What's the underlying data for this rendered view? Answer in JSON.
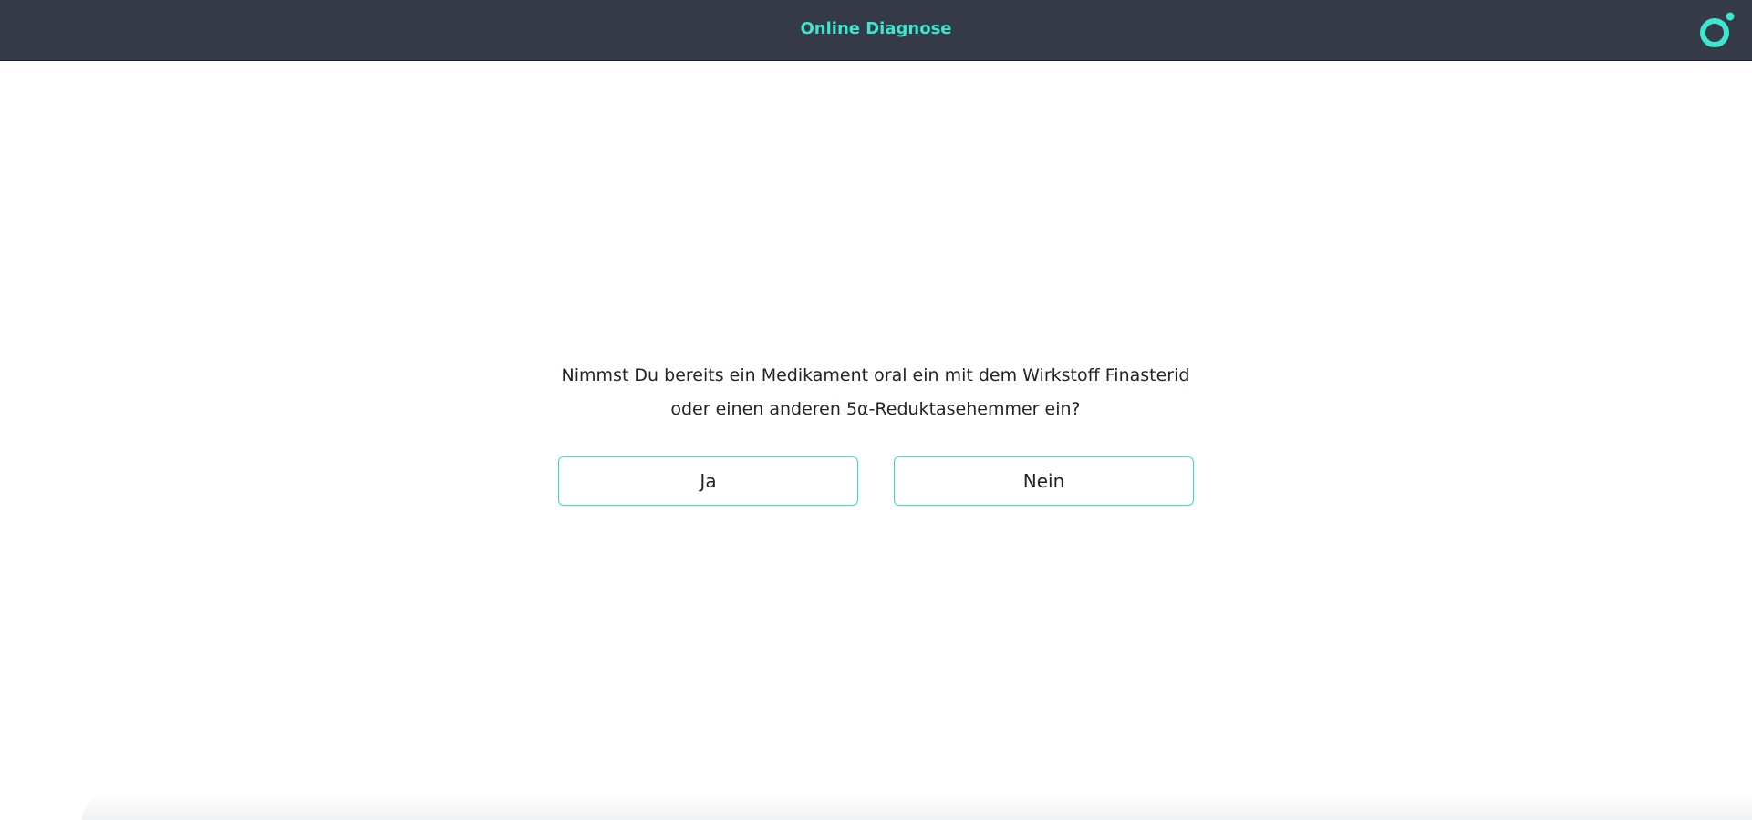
{
  "header": {
    "title": "Online Diagnose",
    "logo_icon": "ring-logo-icon",
    "background_color": "#343a46",
    "accent_color": "#3ee6cd"
  },
  "question": {
    "line1": "Nimmst Du bereits ein Medikament oral ein mit dem Wirkstoff Finasterid",
    "line2": "oder einen anderen 5α-Reduktasehemmer ein?"
  },
  "answers": {
    "yes_label": "Ja",
    "no_label": "Nein",
    "border_color": "#2ee0c4"
  }
}
